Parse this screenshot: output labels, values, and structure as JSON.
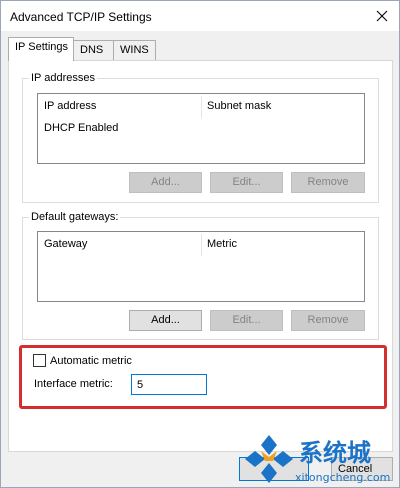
{
  "window": {
    "title": "Advanced TCP/IP Settings",
    "close_glyph": "×"
  },
  "tabs": [
    {
      "label": "IP Settings",
      "active": true
    },
    {
      "label": "DNS",
      "active": false
    },
    {
      "label": "WINS",
      "active": false
    }
  ],
  "ip_addresses": {
    "group_label": "IP addresses",
    "columns": [
      "IP address",
      "Subnet mask"
    ],
    "rows": [
      "DHCP Enabled"
    ],
    "buttons": {
      "add": "Add...",
      "edit": "Edit...",
      "remove": "Remove"
    }
  },
  "default_gateways": {
    "group_label": "Default gateways:",
    "columns": [
      "Gateway",
      "Metric"
    ],
    "buttons": {
      "add": "Add...",
      "edit": "Edit...",
      "remove": "Remove"
    }
  },
  "metric": {
    "automatic_label": "Automatic metric",
    "automatic_checked": false,
    "interface_label": "Interface metric:",
    "interface_value": "5"
  },
  "footer": {
    "cancel_label": "Cancel"
  },
  "watermark": {
    "chinese_text": "系统城",
    "latin_text": "xitongcheng.com"
  },
  "colors": {
    "highlight": "#d42f2f",
    "focus_border": "#0078d7",
    "watermark": "#1a73c7"
  }
}
